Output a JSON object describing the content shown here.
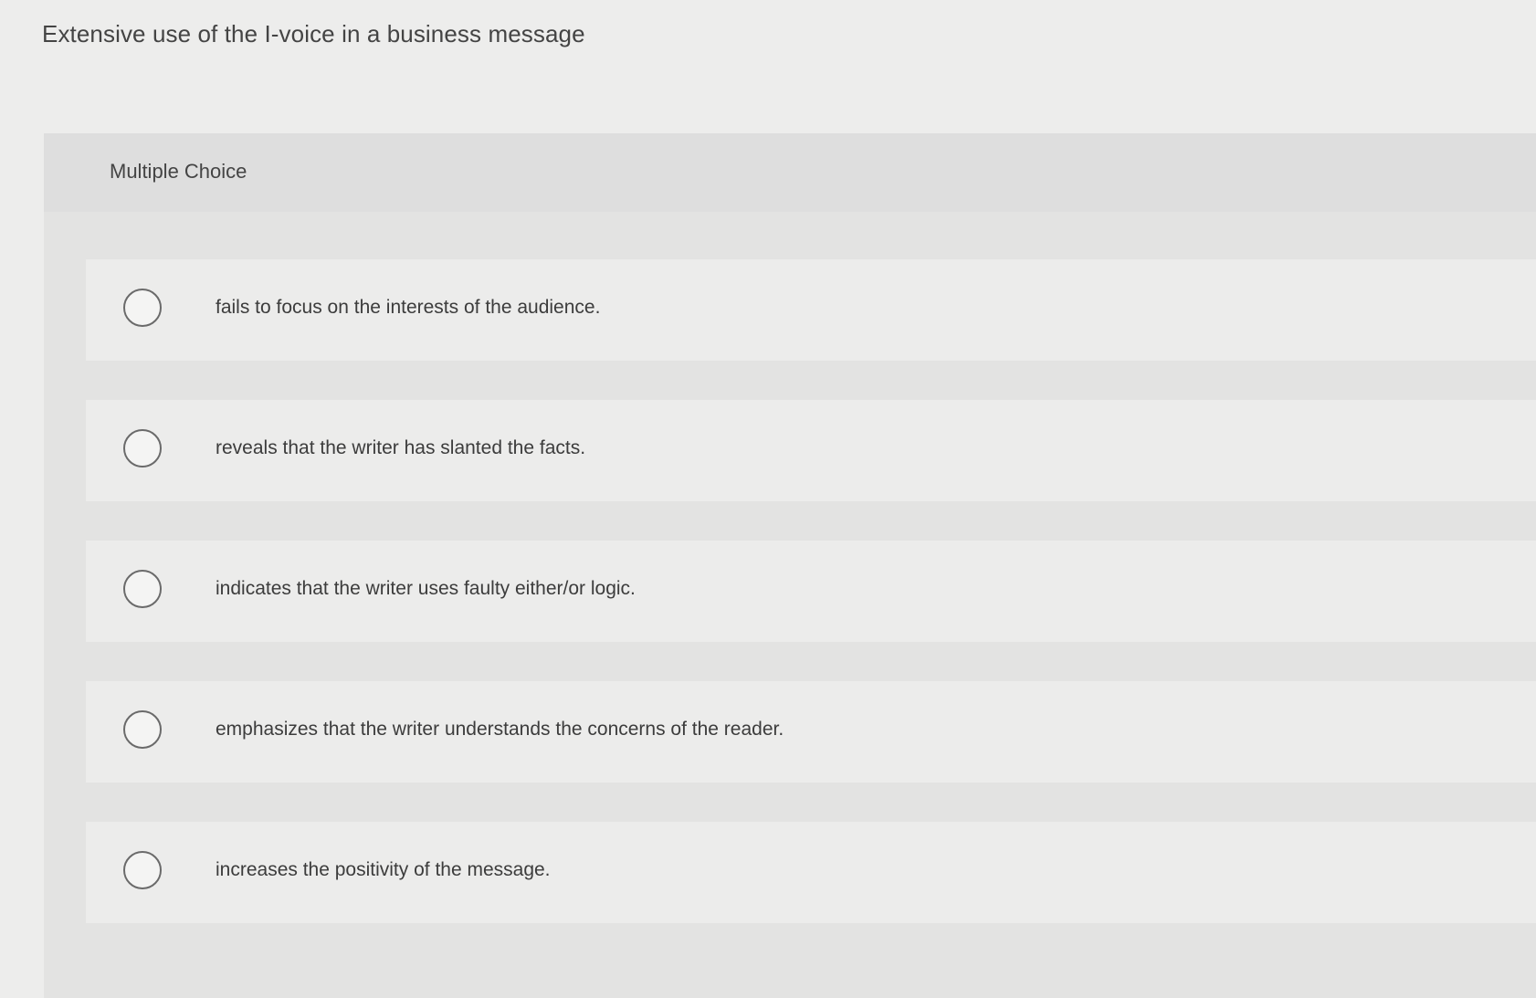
{
  "question": {
    "stem": "Extensive use of the I-voice in a business message",
    "type_label": "Multiple Choice"
  },
  "options": [
    {
      "text": "fails to focus on the interests of the audience.",
      "selected": false
    },
    {
      "text": "reveals that the writer has slanted the facts.",
      "selected": false
    },
    {
      "text": "indicates that the writer uses faulty either/or logic.",
      "selected": false
    },
    {
      "text": "emphasizes that the writer understands the concerns of the reader.",
      "selected": false
    },
    {
      "text": "increases the positivity of the message.",
      "selected": false
    }
  ]
}
